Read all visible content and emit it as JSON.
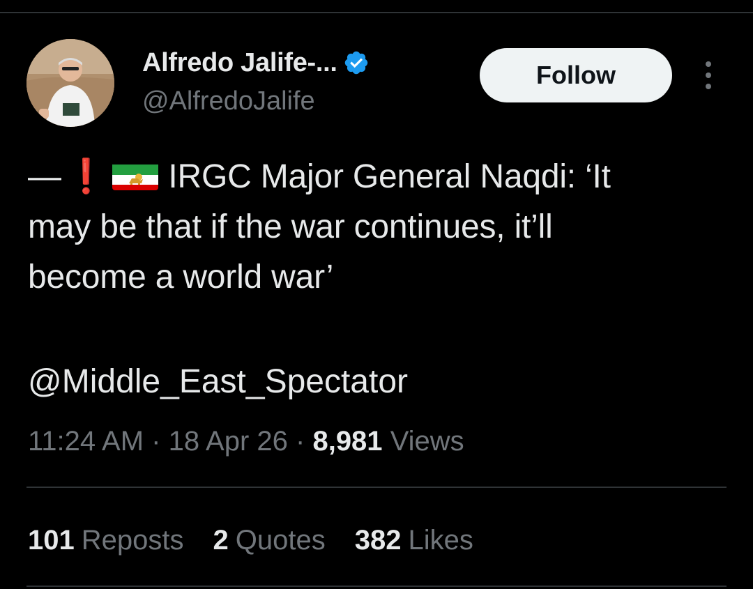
{
  "author": {
    "display_name": "Alfredo Jalife-...",
    "handle": "@AlfredoJalife",
    "verified": true
  },
  "actions": {
    "follow_label": "Follow"
  },
  "tweet": {
    "prefix": "—",
    "exclamation": "❗",
    "flag_icon": "iran-lion-and-sun-flag-icon",
    "lines": [
      "IRGC Major General Naqdi: ‘It",
      "may be that if the war continues, it’ll",
      "become a world war’"
    ],
    "credit": "@Middle_East_Spectator"
  },
  "meta": {
    "time": "11:24 AM",
    "separator": "·",
    "date": "18 Apr 26",
    "views_count": "8,981",
    "views_label": "Views"
  },
  "stats": {
    "reposts_count": "101",
    "reposts_label": "Reposts",
    "quotes_count": "2",
    "quotes_label": "Quotes",
    "likes_count": "382",
    "likes_label": "Likes"
  },
  "colors": {
    "background": "#000000",
    "primary_text": "#e7e9ea",
    "secondary_text": "#71767b",
    "verified_blue": "#1d9bf0",
    "divider": "#2f3336",
    "follow_bg": "#eff3f4",
    "alert_red": "#f4212e"
  }
}
